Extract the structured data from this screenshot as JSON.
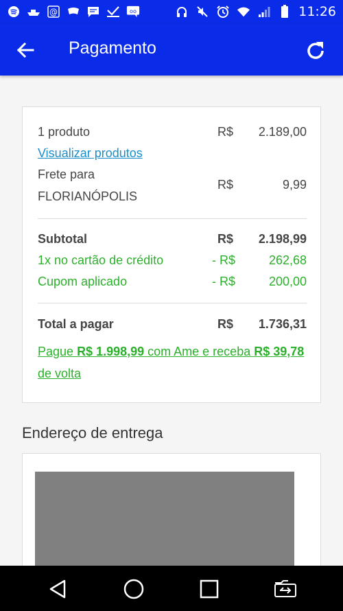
{
  "status_bar": {
    "time": "11:26",
    "left_icons": [
      "spotify-icon",
      "boat-icon",
      "at-icon",
      "tag-icon",
      "message-icon",
      "download-check-icon",
      "chat-icon"
    ],
    "right_icons": [
      "headphones-icon",
      "mute-icon",
      "alarm-icon",
      "wifi-icon",
      "signal-icon",
      "battery-icon"
    ]
  },
  "header": {
    "title": "Pagamento"
  },
  "summary": {
    "products_label": "1 produto",
    "products_currency": "R$",
    "products_value": "2.189,00",
    "view_products_link": "Visualizar produtos",
    "shipping_label_1": "Frete para",
    "shipping_label_2": "FLORIANÓPOLIS",
    "shipping_currency": "R$",
    "shipping_value": "9,99",
    "subtotal_label": "Subtotal",
    "subtotal_currency": "R$",
    "subtotal_value": "2.198,99",
    "card_discount_label": "1x no cartão de crédito",
    "card_discount_currency": "- R$",
    "card_discount_value": "262,68",
    "coupon_label": "Cupom aplicado",
    "coupon_currency": "- R$",
    "coupon_value": "200,00",
    "total_label": "Total a pagar",
    "total_currency": "R$",
    "total_value": "1.736,31",
    "ame_prefix": "Pague ",
    "ame_amount": "R$ 1.998,99",
    "ame_middle": " com Ame e receba ",
    "ame_cashback": "R$ 39,78",
    "ame_suffix": " de volta"
  },
  "delivery": {
    "section_title": "Endereço de entrega"
  },
  "navigation": {
    "buttons": [
      "back-icon",
      "home-icon",
      "recents-icon",
      "switch-sim-icon"
    ]
  },
  "colors": {
    "primary": "#0a2ce8",
    "link": "#1b8fc9",
    "positive": "#2bb02b",
    "map_placeholder": "#808080"
  }
}
